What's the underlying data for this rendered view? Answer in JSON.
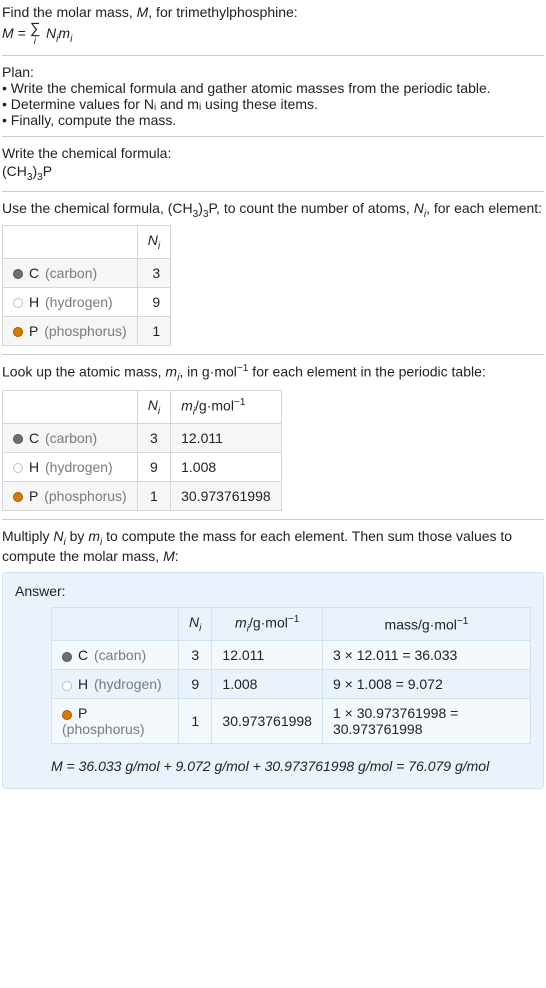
{
  "intro": {
    "line1_pre": "Find the molar mass, ",
    "line1_var": "M",
    "line1_post": ", for trimethylphosphine:",
    "eq_lhs": "M",
    "eq_eqs": " = ",
    "eq_sum_idx": "i",
    "eq_rhs_N": "N",
    "eq_rhs_N_sub": "i",
    "eq_rhs_m": "m",
    "eq_rhs_m_sub": "i"
  },
  "plan": {
    "title": "Plan:",
    "items": [
      "Write the chemical formula and gather atomic masses from the periodic table.",
      "Determine values for Nᵢ and mᵢ using these items.",
      "Finally, compute the mass."
    ]
  },
  "formula_section": {
    "lead": "Write the chemical formula:",
    "formula_a": "(CH",
    "formula_a_sub": "3",
    "formula_b": ")",
    "formula_b_sub": "3",
    "formula_c": "P"
  },
  "count_section": {
    "lead_a": "Use the chemical formula, (CH",
    "lead_a_sub": "3",
    "lead_b": ")",
    "lead_b_sub": "3",
    "lead_c": "P, to count the number of atoms, ",
    "lead_var": "N",
    "lead_var_sub": "i",
    "lead_d": ", for each element:",
    "header_N": "N",
    "header_N_sub": "i",
    "rows": [
      {
        "sym": "C",
        "name": "(carbon)",
        "swatch": "c-c",
        "n": "3"
      },
      {
        "sym": "H",
        "name": "(hydrogen)",
        "swatch": "c-h",
        "n": "9"
      },
      {
        "sym": "P",
        "name": "(phosphorus)",
        "swatch": "c-p",
        "n": "1"
      }
    ]
  },
  "mass_section": {
    "lead_a": "Look up the atomic mass, ",
    "lead_m": "m",
    "lead_m_sub": "i",
    "lead_b": ", in g·mol",
    "lead_b_sup": "−1",
    "lead_c": " for each element in the periodic table:",
    "header_N": "N",
    "header_N_sub": "i",
    "header_m": "m",
    "header_m_sub": "i",
    "header_m_unit": "/g·mol",
    "header_m_unit_sup": "−1",
    "rows": [
      {
        "sym": "C",
        "name": "(carbon)",
        "swatch": "c-c",
        "n": "3",
        "m": "12.011"
      },
      {
        "sym": "H",
        "name": "(hydrogen)",
        "swatch": "c-h",
        "n": "9",
        "m": "1.008"
      },
      {
        "sym": "P",
        "name": "(phosphorus)",
        "swatch": "c-p",
        "n": "1",
        "m": "30.973761998"
      }
    ]
  },
  "compute_section": {
    "lead_a": "Multiply ",
    "lead_N": "N",
    "lead_N_sub": "i",
    "lead_b": " by ",
    "lead_m": "m",
    "lead_m_sub": "i",
    "lead_c": " to compute the mass for each element. Then sum those values to compute the molar mass, ",
    "lead_M": "M",
    "lead_d": ":"
  },
  "answer": {
    "label": "Answer:",
    "header_N": "N",
    "header_N_sub": "i",
    "header_m": "m",
    "header_m_sub": "i",
    "header_m_unit": "/g·mol",
    "header_m_unit_sup": "−1",
    "header_mass": "mass/g·mol",
    "header_mass_sup": "−1",
    "rows": [
      {
        "sym": "C",
        "name": "(carbon)",
        "swatch": "c-c",
        "n": "3",
        "m": "12.011",
        "mass": "3 × 12.011 = 36.033"
      },
      {
        "sym": "H",
        "name": "(hydrogen)",
        "swatch": "c-h",
        "n": "9",
        "m": "1.008",
        "mass": "9 × 1.008 = 9.072"
      },
      {
        "sym": "P",
        "name": "(phosphorus)",
        "swatch": "c-p",
        "n": "1",
        "m": "30.973761998",
        "mass": "1 × 30.973761998 = 30.973761998"
      }
    ],
    "final": "M = 36.033 g/mol + 9.072 g/mol + 30.973761998 g/mol = 76.079 g/mol"
  }
}
